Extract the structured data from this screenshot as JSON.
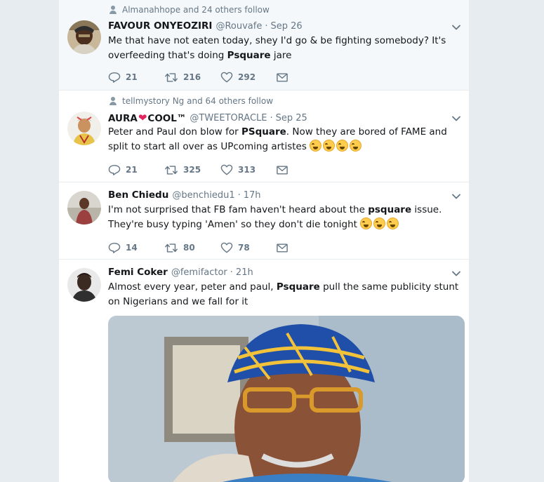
{
  "colors": {
    "accent": "#1da1f2",
    "text": "#14171a",
    "muted": "#657786",
    "heart": "#e0245e",
    "background": "#e6ecf0"
  },
  "tweets": [
    {
      "context": "Almanahhope and 24 others follow",
      "name": "FAVOUR ONYEOZIRI",
      "handle": "@Rouvafe",
      "time": "Sep 26",
      "text_a": "Me that have not eaten today, shey I'd go & be fighting somebody? It's overfeeding that's doing ",
      "text_bold": "Psquare",
      "text_b": " jare",
      "replies": "21",
      "retweets": "216",
      "likes": "292"
    },
    {
      "context": "tellmystory Ng and 64 others follow",
      "name_a": "AURA",
      "name_heart": "❤",
      "name_b": "COOL™",
      "handle": "@TWEETORACLE",
      "time": "Sep 25",
      "text_a": "Peter and Paul don blow for ",
      "text_bold": "PSquare",
      "text_b": ". Now they are bored of FAME and split to start all over as UPcoming artistes",
      "replies": "21",
      "retweets": "325",
      "likes": "313"
    },
    {
      "name": "Ben Chiedu",
      "handle": "@benchiedu1",
      "time": "17h",
      "text_a": "I'm not surprised that FB fam haven't heard about the ",
      "text_bold": "psquare",
      "text_b": " issue.",
      "text_c": "They're busy typing 'Amen' so they don't die tonight",
      "replies": "14",
      "retweets": "80",
      "likes": "78"
    },
    {
      "name": "Femi Coker",
      "handle": "@femifactor",
      "time": "21h",
      "text_a": "Almost every year, peter and paul, ",
      "text_bold": "Psquare",
      "text_b": " pull the same publicity stunt on Nigerians and we fall for it"
    }
  ],
  "icons": [
    "person-icon",
    "reply-icon",
    "retweet-icon",
    "like-icon",
    "direct-message-icon",
    "chevron-down-icon",
    "face-with-tears-of-joy-icon"
  ]
}
